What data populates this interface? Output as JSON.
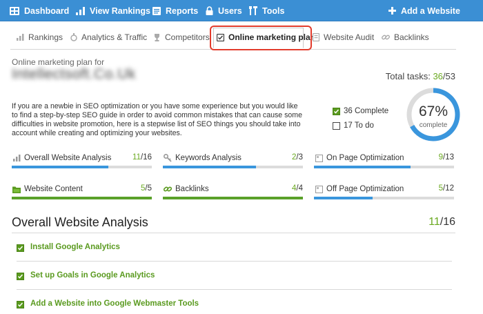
{
  "topnav": {
    "items": [
      {
        "label": "Dashboard",
        "icon": "grid-icon"
      },
      {
        "label": "View Rankings",
        "icon": "bar-chart-icon"
      },
      {
        "label": "Reports",
        "icon": "report-icon"
      },
      {
        "label": "Users",
        "icon": "lock-icon"
      },
      {
        "label": "Tools",
        "icon": "tools-icon"
      }
    ],
    "add_website": "Add a Website",
    "bar_color": "#3b8fd4"
  },
  "tabs": [
    {
      "label": "Rankings",
      "icon": "bar-chart-icon"
    },
    {
      "label": "Analytics & Traffic",
      "icon": "analytics-icon"
    },
    {
      "label": "Competitors",
      "icon": "trophy-icon"
    },
    {
      "label": "Online marketing plan",
      "icon": "checkbox-icon",
      "active": true
    },
    {
      "label": "Website Audit",
      "icon": "audit-icon"
    },
    {
      "label": "Backlinks",
      "icon": "link-icon"
    }
  ],
  "plan": {
    "for_label": "Online marketing plan for",
    "site_name": "Intellectsoft.Co.Uk",
    "total_label": "Total tasks:",
    "total_done": "36",
    "total_all": "/53",
    "intro": "If you are a newbie in SEO optimization or you have some experience but you would like to find a step-by-step SEO guide in order to avoid common mistakes that can cause some difficulties in website promotion, here is a stepwise list of SEO things you should take into account while creating and optimizing your websites.",
    "complete_label": "36 Complete",
    "todo_label": "17 To do",
    "percent": "67%",
    "percent_value": 0.67,
    "percent_caption": "complete"
  },
  "categories": [
    {
      "label": "Overall Website Analysis",
      "done": "11",
      "total": "/16",
      "progress": 0.6875,
      "color": "#3a96dd",
      "icon": "bar-chart-icon"
    },
    {
      "label": "Keywords Analysis",
      "done": "2",
      "total": "/3",
      "progress": 0.667,
      "color": "#3a96dd",
      "icon": "key-icon"
    },
    {
      "label": "On Page Optimization",
      "done": "9",
      "total": "/13",
      "progress": 0.69,
      "color": "#3a96dd",
      "icon": "page-icon"
    },
    {
      "label": "Website Content",
      "done": "5",
      "total": "/5",
      "progress": 1.0,
      "color": "#5aa12a",
      "icon": "folder-icon"
    },
    {
      "label": "Backlinks",
      "done": "4",
      "total": "/4",
      "progress": 1.0,
      "color": "#5aa12a",
      "icon": "link-icon"
    },
    {
      "label": "Off Page Optimization",
      "done": "5",
      "total": "/12",
      "progress": 0.4167,
      "color": "#3a96dd",
      "icon": "page-icon"
    }
  ],
  "section": {
    "title": "Overall Website Analysis",
    "done": "11",
    "total": "/16"
  },
  "tasks": [
    {
      "label": "Install Google Analytics",
      "checked": true
    },
    {
      "label": "Set up Goals in Google Analytics",
      "checked": true
    },
    {
      "label": "Add a Website into Google Webmaster Tools",
      "checked": true
    }
  ],
  "colors": {
    "accent_green": "#6aa920",
    "accent_blue": "#3a96dd",
    "highlight_red": "#e23b2c"
  }
}
